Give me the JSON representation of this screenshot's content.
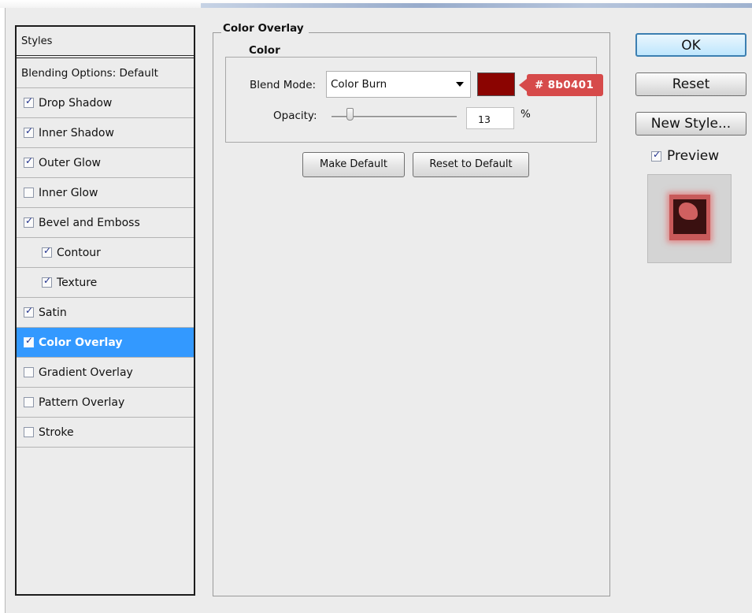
{
  "styles_panel": {
    "header": "Styles",
    "items": [
      {
        "label": "Blending Options: Default",
        "checkbox": false,
        "checked": false,
        "sub": false,
        "selected": false
      },
      {
        "label": "Drop Shadow",
        "checkbox": true,
        "checked": true,
        "sub": false,
        "selected": false
      },
      {
        "label": "Inner Shadow",
        "checkbox": true,
        "checked": true,
        "sub": false,
        "selected": false
      },
      {
        "label": "Outer Glow",
        "checkbox": true,
        "checked": true,
        "sub": false,
        "selected": false
      },
      {
        "label": "Inner Glow",
        "checkbox": true,
        "checked": false,
        "sub": false,
        "selected": false
      },
      {
        "label": "Bevel and Emboss",
        "checkbox": true,
        "checked": true,
        "sub": false,
        "selected": false
      },
      {
        "label": "Contour",
        "checkbox": true,
        "checked": true,
        "sub": true,
        "selected": false
      },
      {
        "label": "Texture",
        "checkbox": true,
        "checked": true,
        "sub": true,
        "selected": false
      },
      {
        "label": "Satin",
        "checkbox": true,
        "checked": true,
        "sub": false,
        "selected": false
      },
      {
        "label": "Color Overlay",
        "checkbox": true,
        "checked": true,
        "sub": false,
        "selected": true
      },
      {
        "label": "Gradient Overlay",
        "checkbox": true,
        "checked": false,
        "sub": false,
        "selected": false
      },
      {
        "label": "Pattern Overlay",
        "checkbox": true,
        "checked": false,
        "sub": false,
        "selected": false
      },
      {
        "label": "Stroke",
        "checkbox": true,
        "checked": false,
        "sub": false,
        "selected": false
      }
    ]
  },
  "color_overlay": {
    "section_title": "Color Overlay",
    "color_group_title": "Color",
    "blend_mode_label": "Blend Mode:",
    "blend_mode_value": "Color Burn",
    "overlay_color": "#8b0401",
    "color_annotation": "# 8b0401",
    "opacity_label": "Opacity:",
    "opacity_value": "13",
    "opacity_unit": "%",
    "make_default_label": "Make Default",
    "reset_to_default_label": "Reset to Default"
  },
  "actions": {
    "ok_label": "OK",
    "reset_label": "Reset",
    "new_style_label": "New Style...",
    "preview_label": "Preview",
    "preview_checked": true
  },
  "colors": {
    "selection": "#3399ff",
    "annotation_bg": "#d64a4a"
  }
}
